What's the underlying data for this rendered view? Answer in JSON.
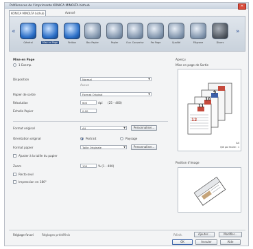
{
  "window": {
    "title": "Préférences de l'imprimante KONICA MINOLTA bizhub"
  },
  "tabs": [
    {
      "label": "KONICA MINOLTA bizhub"
    },
    {
      "label": "Avancé"
    }
  ],
  "toolbar": {
    "items": [
      {
        "label": "Général",
        "icon": "printer-icon"
      },
      {
        "label": "Mise en Page",
        "icon": "layout-icon"
      },
      {
        "label": "Finition",
        "icon": "finishing-icon"
      },
      {
        "label": "Bac Papier",
        "icon": "paper-tray-icon"
      },
      {
        "label": "Papier",
        "icon": "paper-icon"
      },
      {
        "label": "Ouv. Couverture",
        "icon": "cover-icon"
      },
      {
        "label": "Par Page",
        "icon": "per-page-icon"
      },
      {
        "label": "Qualité",
        "icon": "quality-icon"
      },
      {
        "label": "Filigrane",
        "icon": "watermark-icon"
      },
      {
        "label": "Divers",
        "icon": "misc-icon"
      }
    ],
    "more": "»"
  },
  "left": {
    "section_title": "Mise en Page",
    "copies_label": "1 Exemp.",
    "source_label": "Disposition",
    "source_value": "Normal",
    "sub_label": "Aucun",
    "paper_size_label": "Papier de sortie",
    "paper_size_value": "Format Original",
    "res_label": "Résolution",
    "res_value": "600",
    "res_unit": "dpi",
    "res_range": "(25 - 400)",
    "chars_label": "Échelle Papier",
    "chars_value": "0.00",
    "orient_label": "Format original",
    "orient_value": "A4",
    "custom_btn": "Personnaliser...",
    "orientation_label": "Orientation original",
    "portrait": "Portrait",
    "landscape": "Paysage",
    "output_label": "Format papier",
    "output_value": "Taille Originale",
    "custom_btn2": "Personnaliser...",
    "fit_label": "Ajuster à la taille du papier",
    "zoom_label": "Zoom",
    "zoom_value": "100",
    "zoom_range": "% (1 - 400)",
    "check1": "Recto seul",
    "check2": "Impression en 180°"
  },
  "right": {
    "preview_label": "Aperçu",
    "preview_sub": "Mise en page de Sortie",
    "pages": [
      "12",
      "11",
      "10",
      "9"
    ],
    "preview_size": "A4",
    "preview_meta": "Qté par feuille : 1",
    "info_label": "Position d'Image"
  },
  "bottom": {
    "favorites_label": "Réglage favori",
    "favorites_value": "Réglages prédéfinis",
    "add_btn": "Ajouter...",
    "edit_btn": "Modifier...",
    "ok": "OK",
    "cancel": "Annuler",
    "help": "Aide",
    "reset_label": "Réinit."
  }
}
